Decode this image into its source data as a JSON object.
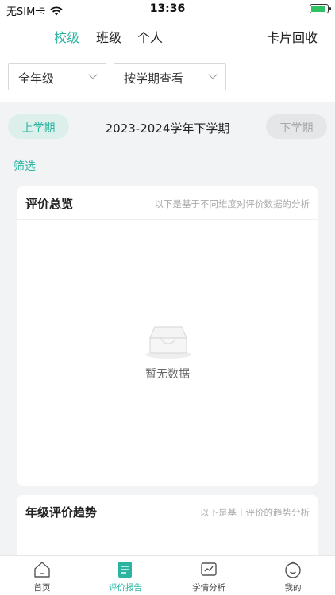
{
  "status_bar": {
    "carrier": "无SIM卡",
    "time": "13:36"
  },
  "top_tabs": {
    "items": [
      {
        "label": "校级",
        "active": true
      },
      {
        "label": "班级",
        "active": false
      },
      {
        "label": "个人",
        "active": false
      }
    ],
    "card_recycle": "卡片回收"
  },
  "filters": {
    "grade": "全年级",
    "view_mode": "按学期查看"
  },
  "term_switcher": {
    "prev": "上学期",
    "current": "2023-2024学年下学期",
    "next": "下学期"
  },
  "filter_link": "筛选",
  "overview_card": {
    "title": "评价总览",
    "subtitle": "以下是基于不同维度对评价数据的分析",
    "empty_text": "暂无数据"
  },
  "trend_card": {
    "title": "年级评价趋势",
    "subtitle": "以下是基于评价的趋势分析"
  },
  "bottom_nav": {
    "items": [
      {
        "label": "首页",
        "icon": "home-icon",
        "active": false
      },
      {
        "label": "评价报告",
        "icon": "report-icon",
        "active": true
      },
      {
        "label": "学情分析",
        "icon": "analysis-icon",
        "active": false
      },
      {
        "label": "我的",
        "icon": "profile-icon",
        "active": false
      }
    ]
  },
  "colors": {
    "accent": "#2bb5a1",
    "background": "#f2f3f5",
    "battery": "#2ec262"
  }
}
